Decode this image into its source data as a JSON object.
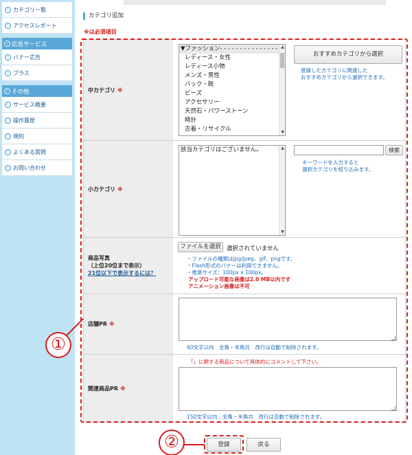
{
  "sidebar": {
    "items_top": [
      {
        "label": "カテゴリ一覧"
      },
      {
        "label": "アクセスレポート"
      }
    ],
    "sections": [
      {
        "title": "広告サービス",
        "items": [
          {
            "label": "バナー広告"
          },
          {
            "label": "プラス"
          }
        ]
      },
      {
        "title": "その他",
        "items": [
          {
            "label": "サービス概要"
          },
          {
            "label": "操作履歴"
          },
          {
            "label": "規約"
          },
          {
            "label": "よくある質問"
          },
          {
            "label": "お問い合わせ"
          }
        ]
      }
    ]
  },
  "page": {
    "title": "カテゴリ追加",
    "required_note": "※は必須項目"
  },
  "form": {
    "required_mark": "※",
    "main_category": {
      "label": "中カテゴリ",
      "options": [
        "▼ファッション- - - - - - - - - - - - - - - - - -",
        "レディース・女性",
        "レディース小物",
        "メンズ・男性",
        "バック・靴",
        "ビーズ",
        "アクセサリー",
        "天然石・パワーストーン",
        "時計",
        "古着・リサイクル"
      ],
      "recommend_button": "おすすめカテゴリから選択",
      "recommend_hint_1": "登録したカテゴリに関連した",
      "recommend_hint_2": "おすすめカテゴリから選択できます。"
    },
    "sub_category": {
      "label": "小カテゴリ",
      "empty_text": "該当カテゴリはございません。",
      "search_button": "検索",
      "search_value": "",
      "hint_1": "キーワードを入力すると",
      "hint_2": "選択カテゴリを絞り込みます。"
    },
    "photo": {
      "label_1": "商品写真",
      "label_2": "（上位20位まで表示）",
      "help_link": "21位以下で表示するには？",
      "file_button": "ファイルを選択",
      "file_status": "選択されていません",
      "note_1": "・ファイルの種類はjpg/jpeg、gif、pngです。",
      "note_2": "・Flash形式のバナーは利用できません。",
      "note_3": "・推奨サイズ：100px x 100px。",
      "warn_1": "アップロード可能な画像は2.0 MB以内です",
      "warn_2": "アニメーション画像は不可"
    },
    "shop_pr": {
      "label": "店舗PR",
      "value": "",
      "hint": "60文字以内　全角・半角共　改行は自動で削除されます。"
    },
    "related_pr": {
      "label": "関連商品PR",
      "top_note": "「」に関する商品について具体的にコメントして下さい。",
      "value": "",
      "hint": "150文字以内　全角・半角共　改行は自動で削除されます。"
    }
  },
  "actions": {
    "register": "登録",
    "back": "戻る"
  },
  "annotations": {
    "callout_1": "①",
    "callout_2": "②",
    "color": "#d81c1c"
  }
}
